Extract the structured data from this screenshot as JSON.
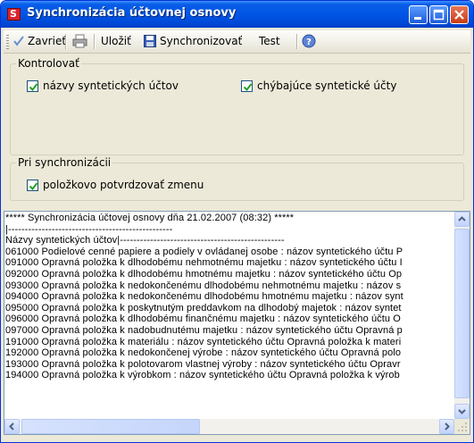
{
  "window": {
    "title": "Synchronizácia účtovnej osnovy"
  },
  "toolbar": {
    "close_label": "Zavrieť",
    "save_label": "Uložiť",
    "sync_label": "Synchronizovať",
    "test_label": "Test"
  },
  "group_check": {
    "title": "Kontrolovať",
    "opt1_label": "názvy syntetických účtov",
    "opt1_checked": true,
    "opt2_label": "chýbajúce syntetické účty",
    "opt2_checked": true
  },
  "group_sync": {
    "title": "Pri synchronizácii",
    "opt1_label": "položkovo potvrdzovať zmenu",
    "opt1_checked": true
  },
  "log": {
    "lines": [
      "***** Synchronizácia účtovej osnovy dňa 21.02.2007 (08:32) *****",
      "|-------------------------------------------------",
      "Názvy syntetických účtov|-------------------------------------------------",
      "061000 Podielové cenné papiere a podiely v ovládanej osobe : názov syntetického účtu P",
      "091000 Opravná položka k dlhodobému nehmotnému majetku : názov syntetického účtu I",
      "092000 Opravná položka k dlhodobému hmotnému majetku : názov syntetického účtu Op",
      "093000 Opravná položka k nedokončenému dlhodobému nehmotnému majetku : názov s",
      "094000 Opravná položka k nedokončenému dlhodobému hmotnému majetku : názov synt",
      "095000 Opravná položka k poskytnutým preddavkom na dlhodobý majetok : názov syntet",
      "096000 Opravná položka k dlhodobému finančnému majetku : názov syntetického účtu O",
      "097000 Opravná položka k nadobudnutému majetku : názov syntetického účtu Opravná p",
      "191000 Opravná položka k materiálu : názov syntetického účtu Opravná položka k materi",
      "192000 Opravná položka k nedokončenej výrobe : názov syntetického účtu Opravná polo",
      "193000 Opravná položka k polotovarom vlastnej výroby : názov syntetického účtu Opravr",
      "194000 Opravná položka k výrobkom : názov syntetického účtu Opravná položka k výrob"
    ]
  }
}
